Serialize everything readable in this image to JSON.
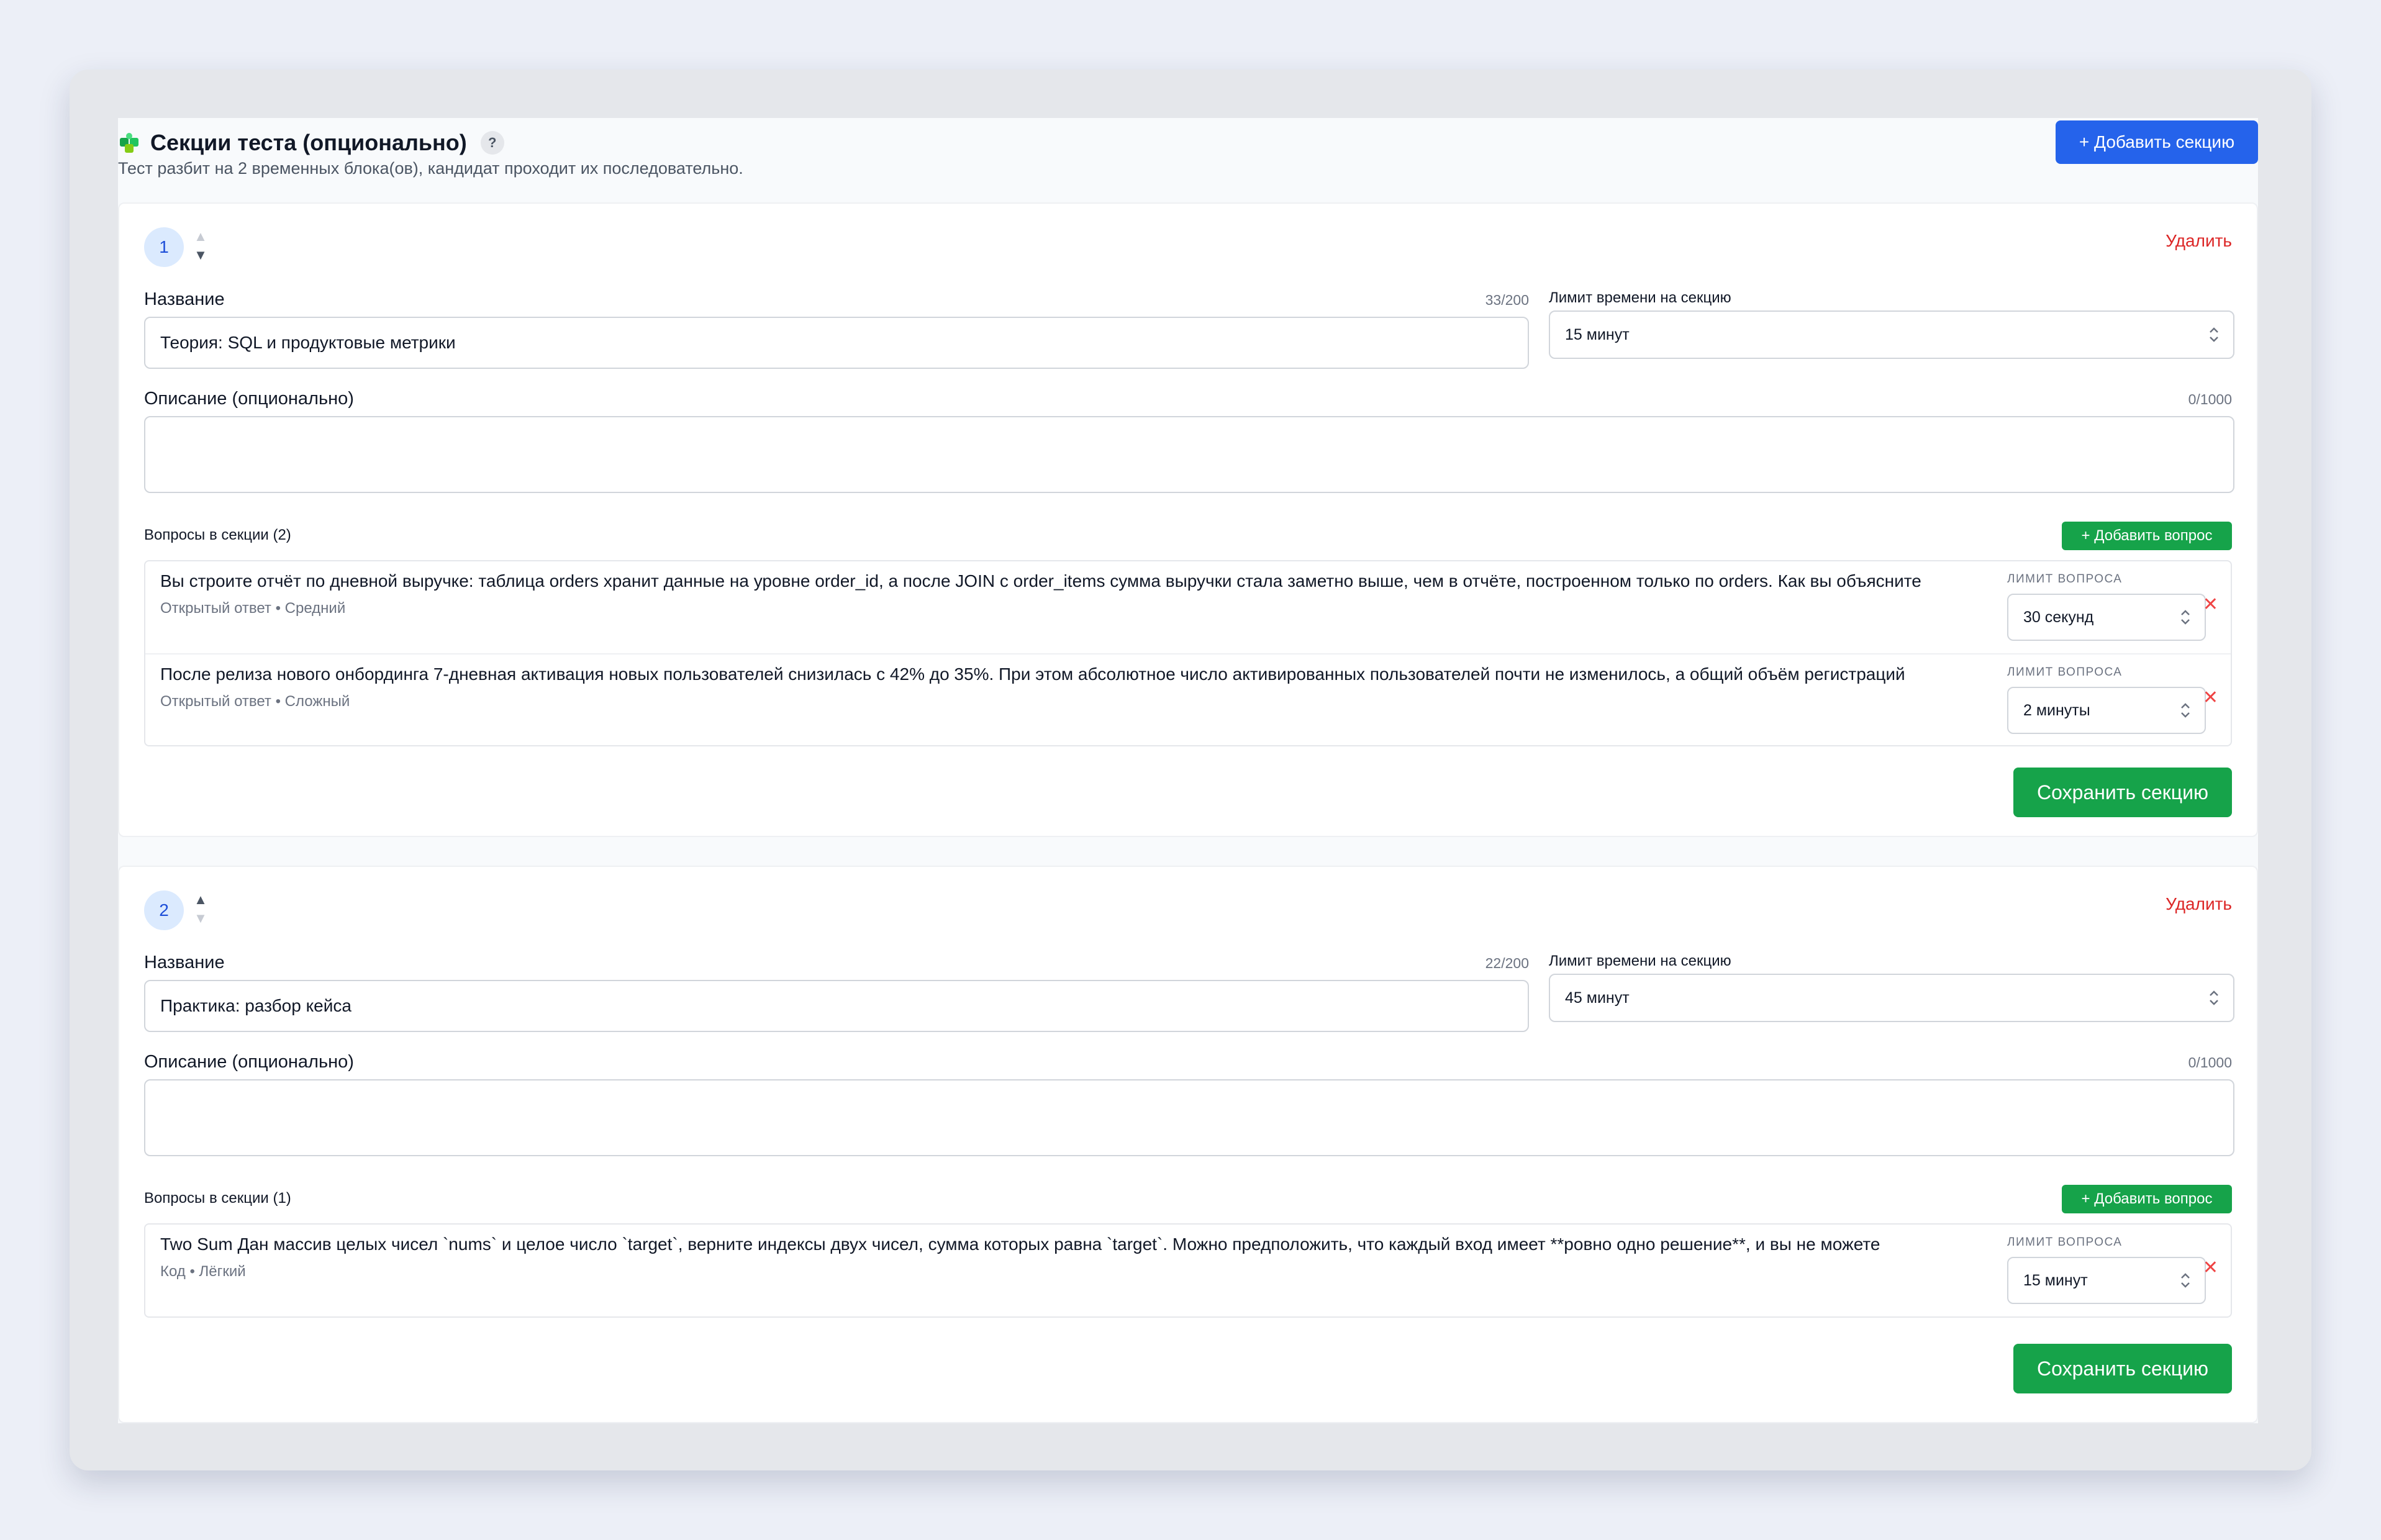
{
  "header": {
    "title": "Секции теста (опционально)",
    "help": "?",
    "subtitle": "Тест разбит на 2 временных блока(ов), кандидат проходит их последовательно.",
    "add_section_label": "+ Добавить секцию"
  },
  "labels": {
    "name": "Название",
    "time_limit": "Лимит времени на секцию",
    "description": "Описание (опционально)",
    "delete": "Удалить",
    "add_question": "+ Добавить вопрос",
    "question_limit": "ЛИМИТ ВОПРОСА",
    "save_section": "Сохранить секцию",
    "remove": "✕"
  },
  "sections": [
    {
      "number": "1",
      "name_counter": "33/200",
      "name_value": "Теория: SQL и продуктовые метрики",
      "time_limit": "15 минут",
      "desc_counter": "0/1000",
      "questions_title": "Вопросы в секции (2)",
      "questions": [
        {
          "text": "Вы строите отчёт по дневной выручке: таблица orders хранит данные на уровне order_id, а после JOIN с order_items сумма выручки стала заметно выше, чем в отчёте, построенном только по orders. Как вы объясните",
          "meta": "Открытый ответ • Средний",
          "limit": "30 секунд"
        },
        {
          "text": "После релиза нового онбординга 7-дневная активация новых пользователей снизилась с 42% до 35%. При этом абсолютное число активированных пользователей почти не изменилось, а общий объём регистраций",
          "meta": "Открытый ответ • Сложный",
          "limit": "2 минуты"
        }
      ]
    },
    {
      "number": "2",
      "name_counter": "22/200",
      "name_value": "Практика: разбор кейса",
      "time_limit": "45 минут",
      "desc_counter": "0/1000",
      "questions_title": "Вопросы в секции (1)",
      "questions": [
        {
          "text": "Two Sum Дан массив целых чисел `nums` и целое число `target`, верните индексы двух чисел, сумма которых равна `target`. Можно предположить, что каждый вход имеет **ровно одно решение**, и вы не можете",
          "meta": "Код • Лёгкий",
          "limit": "15 минут"
        }
      ]
    }
  ],
  "colors": {
    "primary": "#2563eb",
    "success": "#16a34a",
    "danger": "#dc2626"
  },
  "icons": [
    "puzzle-icon",
    "help-icon",
    "chevron-updown-icon",
    "arrow-up-icon",
    "arrow-down-icon",
    "close-icon"
  ]
}
